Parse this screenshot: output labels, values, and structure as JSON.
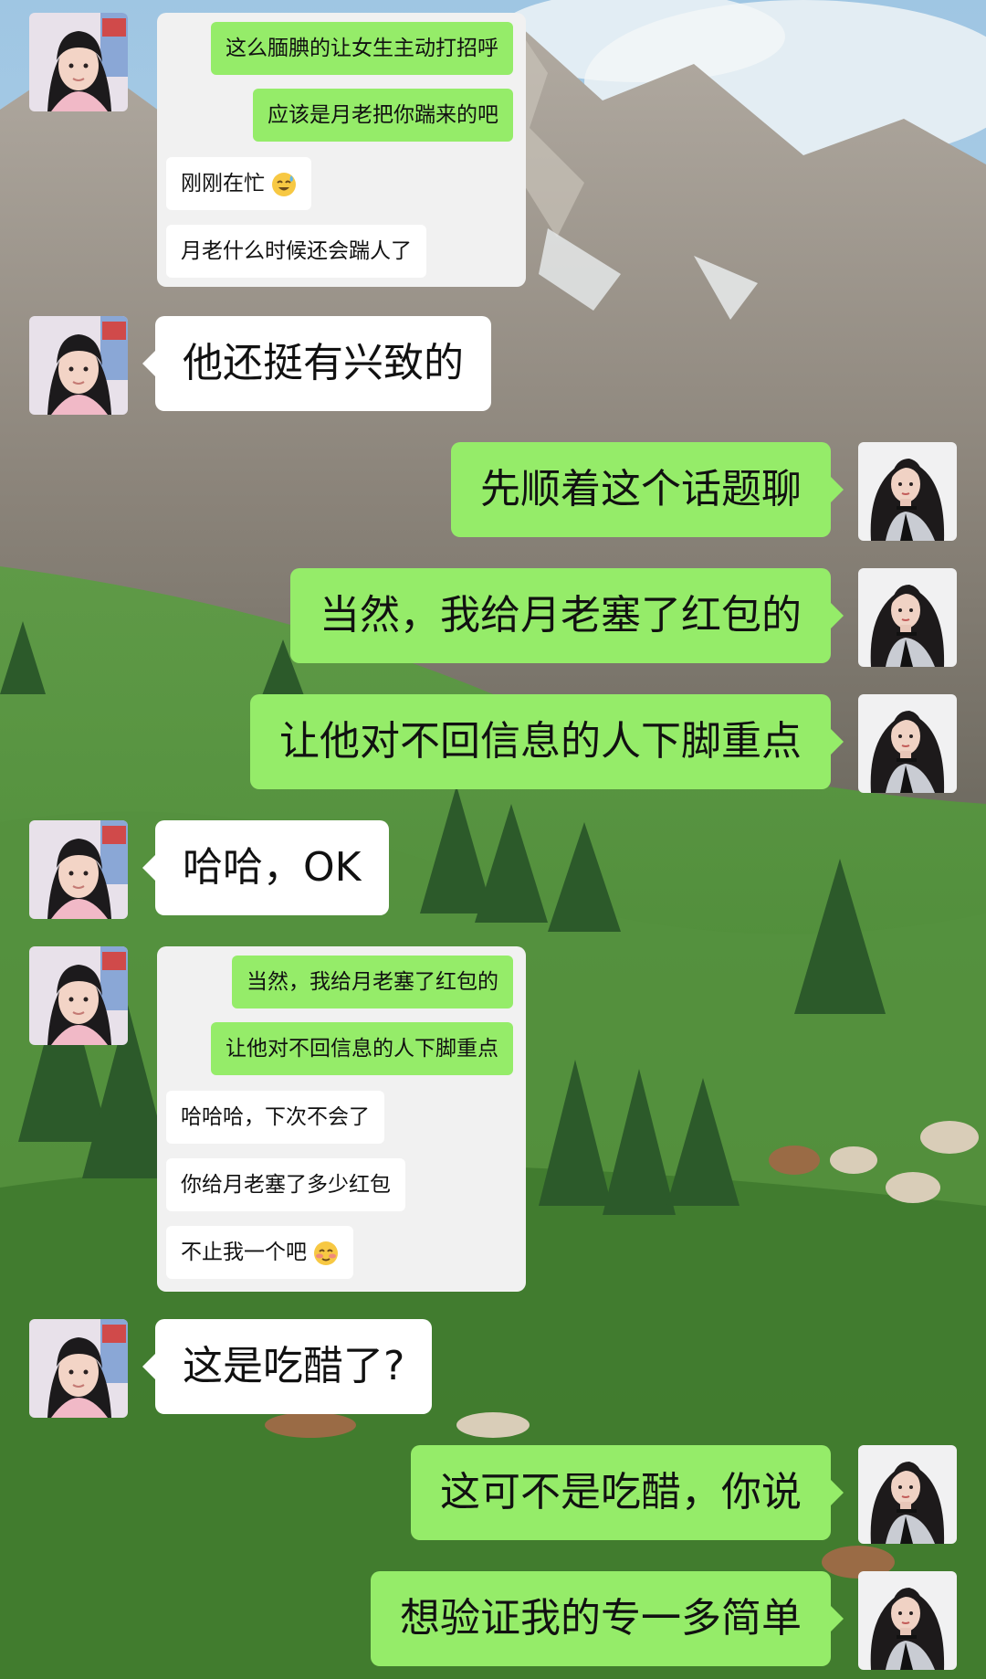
{
  "quote_card_1": {
    "messages": [
      {
        "side": "out",
        "text": "这么腼腆的让女生主动打招呼"
      },
      {
        "side": "out",
        "text": "应该是月老把你踹来的吧"
      },
      {
        "side": "in",
        "text": "刚刚在忙",
        "emoji": "sweat-laugh-emoji"
      },
      {
        "side": "in",
        "text": "月老什么时候还会踹人了"
      }
    ]
  },
  "messages": [
    {
      "side": "in",
      "text": "他还挺有兴致的"
    },
    {
      "side": "out",
      "text": "先顺着这个话题聊"
    },
    {
      "side": "out",
      "text": "当然，我给月老塞了红包的"
    },
    {
      "side": "out",
      "text": "让他对不回信息的人下脚重点"
    },
    {
      "side": "in",
      "text": "哈哈，OK"
    },
    {
      "side": "in",
      "text": "这是吃醋了?"
    },
    {
      "side": "out",
      "text": "这可不是吃醋，你说"
    },
    {
      "side": "out",
      "text": "想验证我的专一多简单"
    }
  ],
  "quote_card_2": {
    "messages": [
      {
        "side": "out",
        "text": "当然，我给月老塞了红包的"
      },
      {
        "side": "out",
        "text": "让他对不回信息的人下脚重点"
      },
      {
        "side": "in",
        "text": "哈哈哈，下次不会了"
      },
      {
        "side": "in",
        "text": "你给月老塞了多少红包"
      },
      {
        "side": "in",
        "text": "不止我一个吧",
        "emoji": "flushed-emoji"
      }
    ]
  },
  "colors": {
    "sent_bubble": "#95ec69",
    "received_bubble": "#ffffff",
    "quote_card": "#f1f1f1"
  }
}
